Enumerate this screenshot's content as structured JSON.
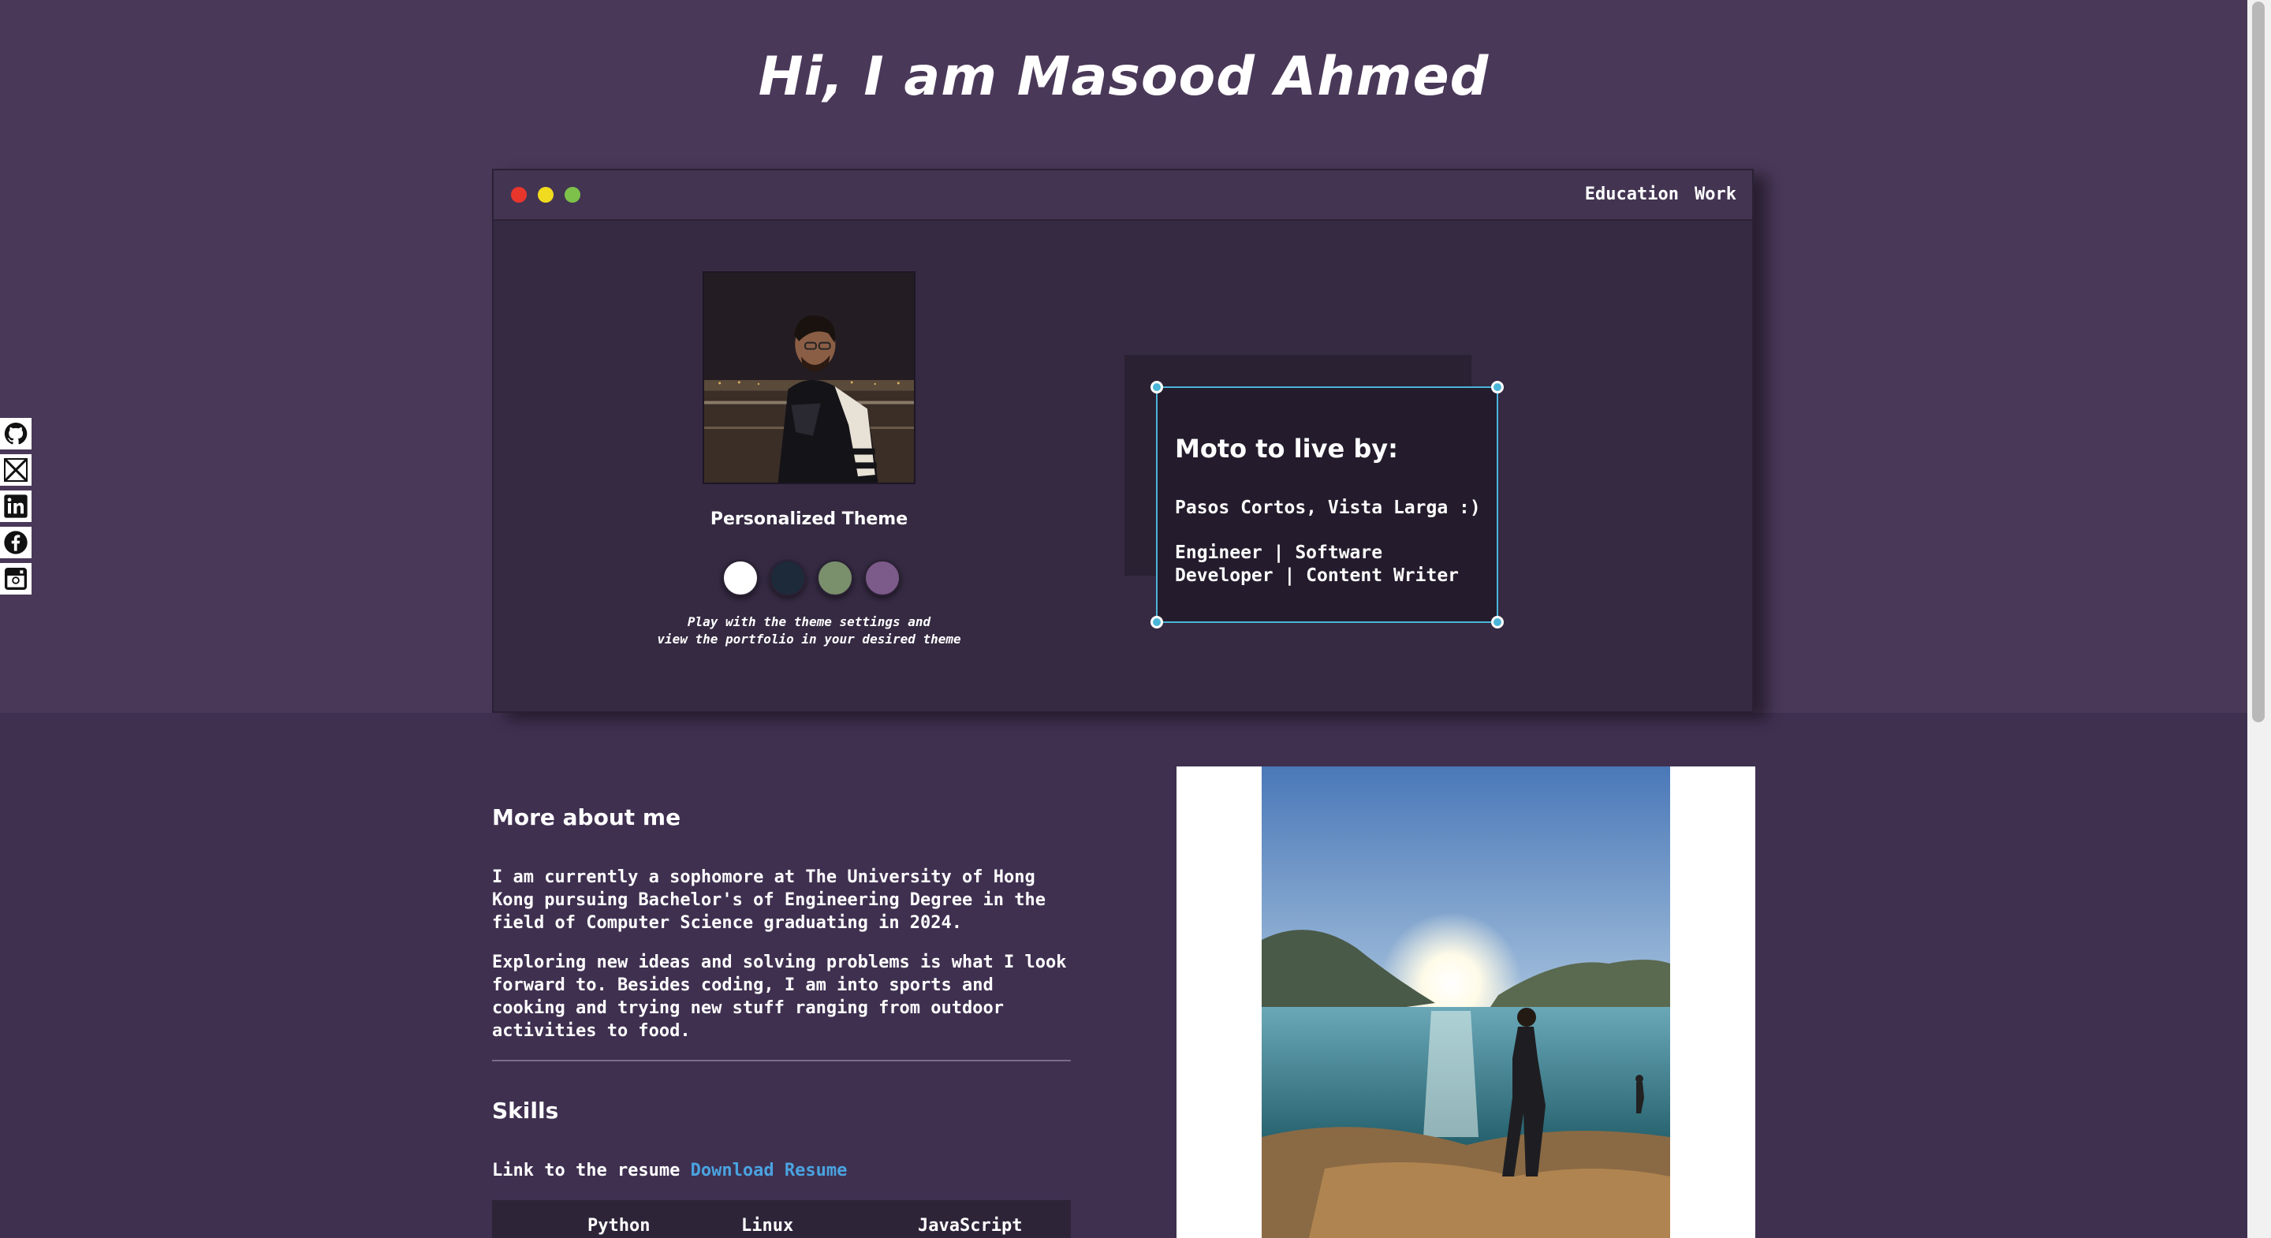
{
  "hero": {
    "title": "Hi, I am Masood Ahmed"
  },
  "social": [
    {
      "icon": "github-icon"
    },
    {
      "icon": "x-icon"
    },
    {
      "icon": "linkedin-icon"
    },
    {
      "icon": "facebook-icon"
    },
    {
      "icon": "instagram-icon"
    }
  ],
  "window": {
    "nav": [
      "Education",
      "Work"
    ],
    "theme_heading": "Personalized Theme",
    "theme_colors": [
      "#ffffff",
      "#1d2a3a",
      "#7a8f6c",
      "#7c5a8a"
    ],
    "theme_note": "Play with the theme settings and\nview the portfolio in your desired theme",
    "moto_title": "Moto to live by:",
    "moto_line1": "Pasos Cortos, Vista Larga :)",
    "moto_line2": "Engineer | Software Developer | Content Writer"
  },
  "about": {
    "heading": "More about me",
    "p1": "I am currently a sophomore at The University of Hong Kong pursuing Bachelor's of Engineering Degree in the field of Computer Science graduating in 2024.",
    "p2": "Exploring new ideas and solving problems is what I look forward to. Besides coding, I am into sports and cooking and trying new stuff ranging from outdoor activities to food."
  },
  "skills": {
    "heading": "Skills",
    "resume_prefix": "Link to the resume",
    "resume_link": "Download Resume",
    "items": [
      "Python",
      "Linux",
      "JavaScript"
    ]
  },
  "colors": {
    "hero_bg": "#4a3859",
    "page_bg": "#3f3050",
    "accent": "#4ab5d8",
    "link": "#4aa3e0"
  }
}
